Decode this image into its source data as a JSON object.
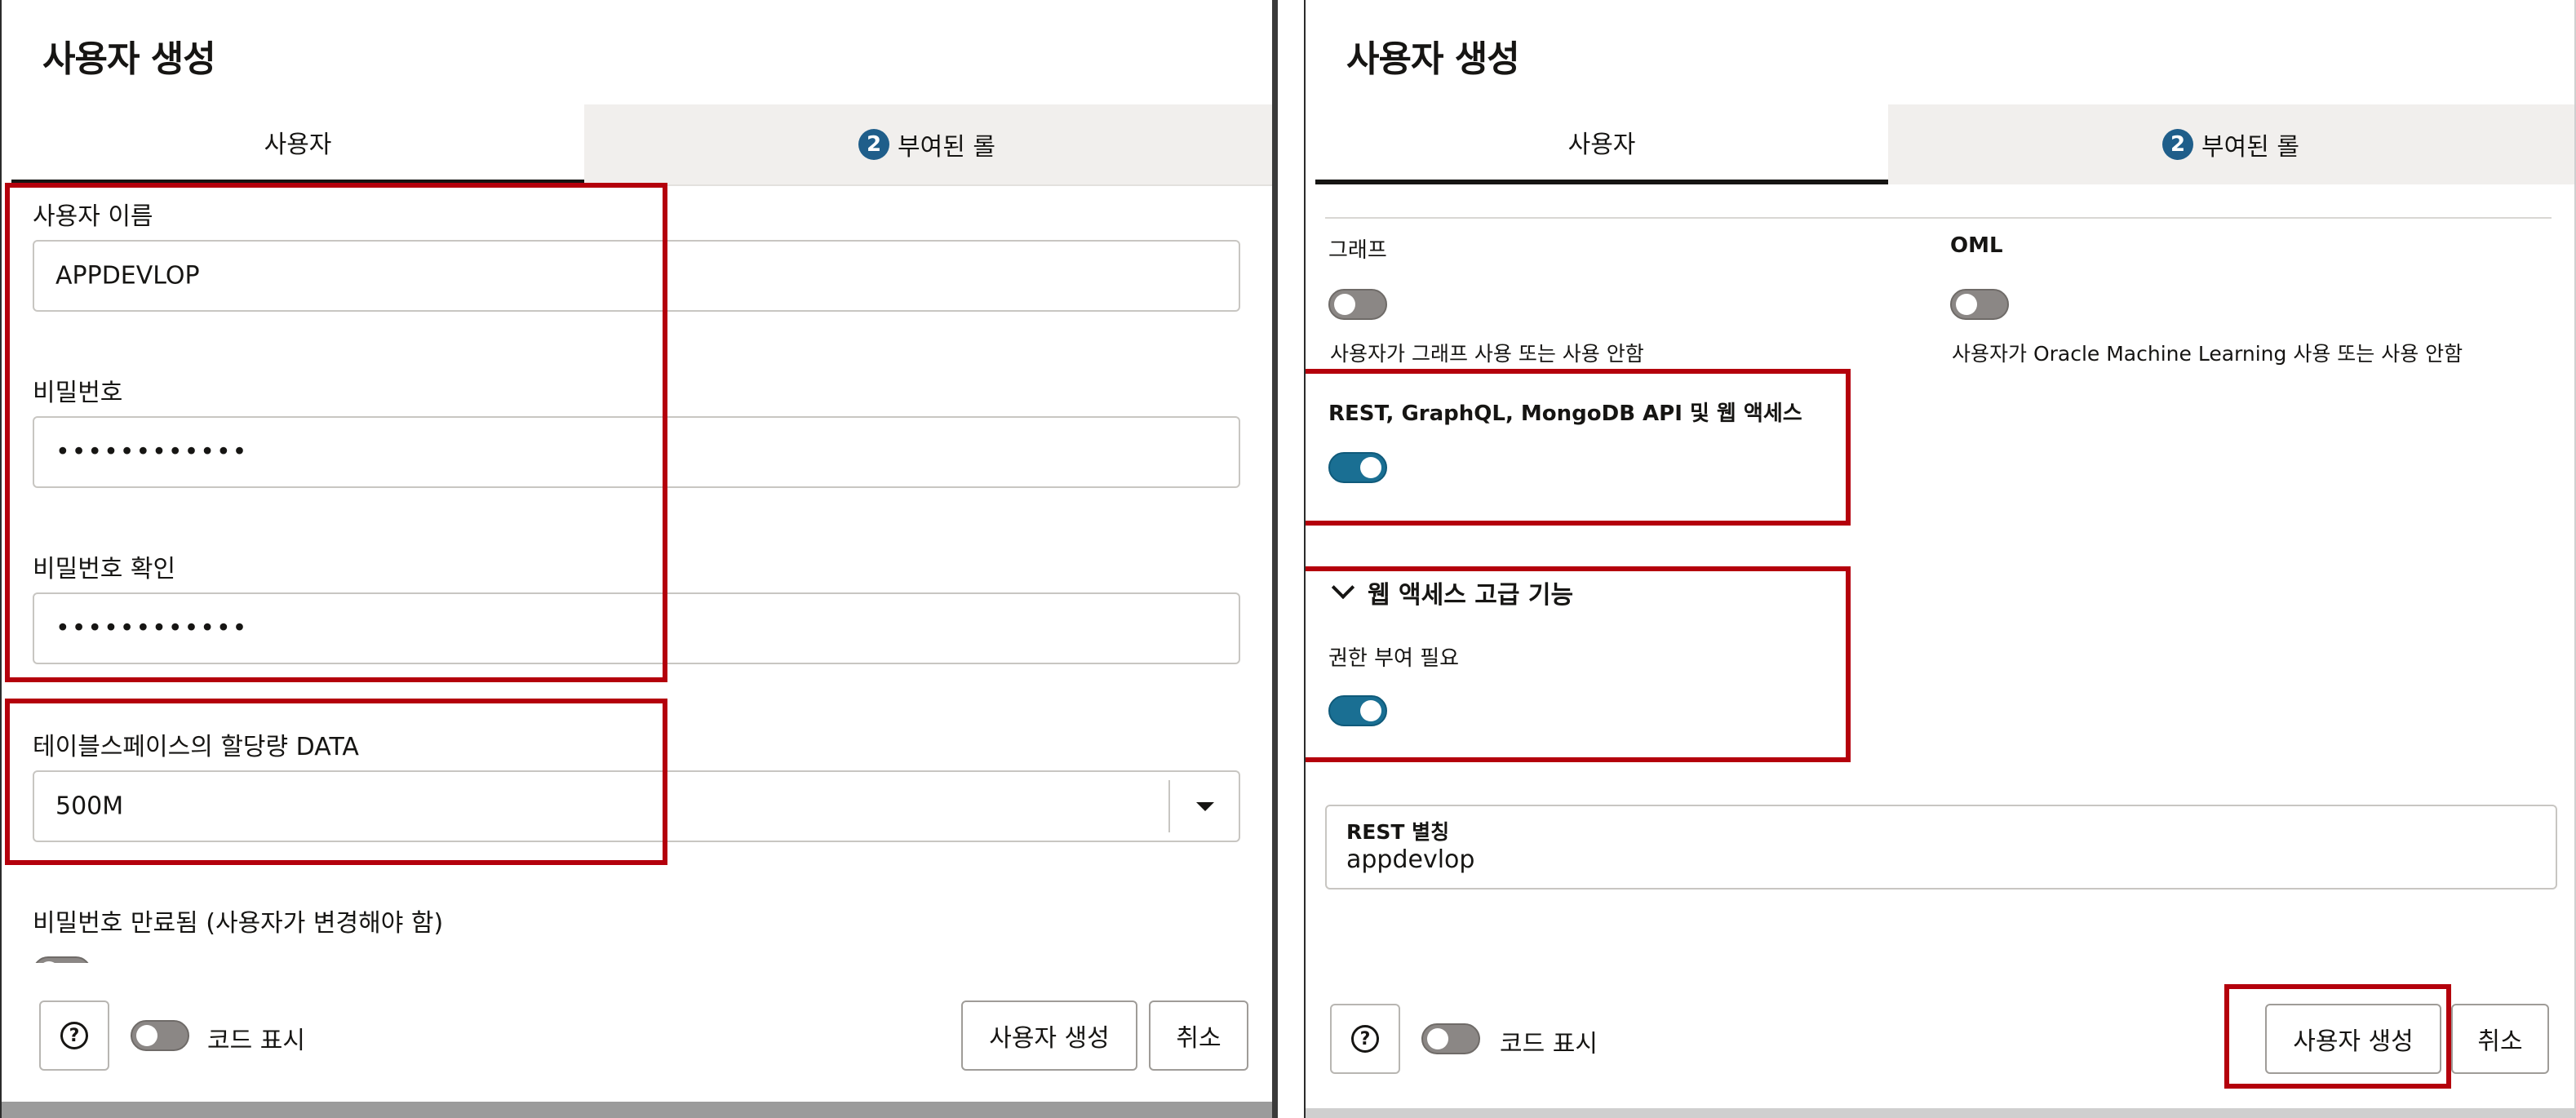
{
  "left": {
    "title": "사용자 생성",
    "tabs": [
      {
        "label": "사용자"
      },
      {
        "badge": "2",
        "label": "부여된 롤"
      }
    ],
    "username": {
      "label": "사용자 이름",
      "value": "APPDEVLOP"
    },
    "password": {
      "label": "비밀번호",
      "value": "••••••••••••"
    },
    "password_confirm": {
      "label": "비밀번호 확인",
      "value": "••••••••••••"
    },
    "quota": {
      "label": "테이블스페이스의 할당량 DATA",
      "value": "500M"
    },
    "password_expired": {
      "label": "비밀번호 만료됨 (사용자가 변경해야 함)"
    },
    "footer": {
      "help": "?",
      "show_code": "코드 표시",
      "create": "사용자 생성",
      "cancel": "취소"
    }
  },
  "right": {
    "title": "사용자 생성",
    "tabs": [
      {
        "label": "사용자"
      },
      {
        "badge": "2",
        "label": "부여된 롤"
      }
    ],
    "graph": {
      "label": "그래프",
      "desc": "사용자가 그래프 사용 또는 사용 안함",
      "on": false
    },
    "oml": {
      "label": "OML",
      "desc": "사용자가 Oracle Machine Learning 사용 또는 사용 안함",
      "on": false
    },
    "rest": {
      "label": "REST, GraphQL, MongoDB API 및 웹 액세스",
      "on": true
    },
    "advanced": {
      "title": "웹 액세스 고급 기능",
      "auth_label": "권한 부여 필요",
      "on": true
    },
    "alias": {
      "label": "REST 별칭",
      "value": "appdevlop"
    },
    "footer": {
      "help": "?",
      "show_code": "코드 표시",
      "create": "사용자 생성",
      "cancel": "취소"
    }
  },
  "colors": {
    "accent": "#1a6f93",
    "highlight": "#b4000c",
    "badge": "#1f5e8a"
  }
}
